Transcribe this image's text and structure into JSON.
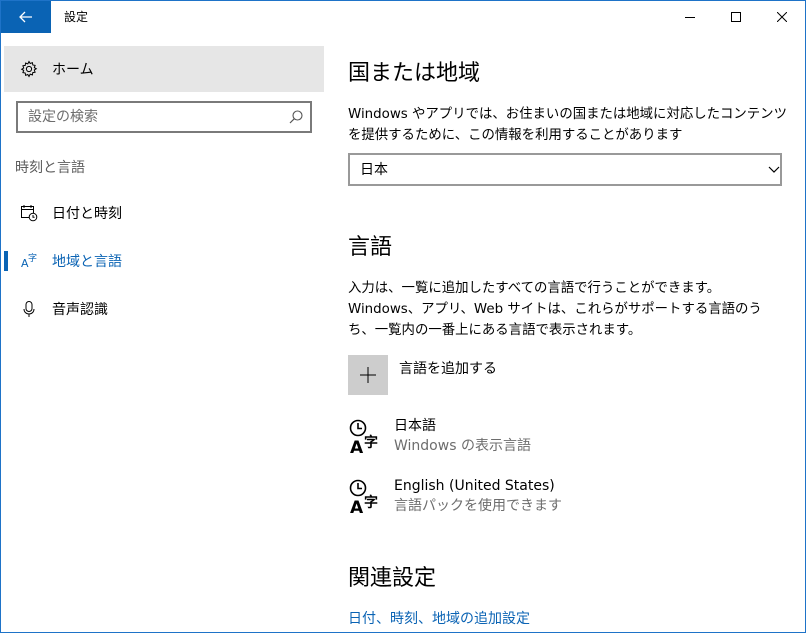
{
  "window": {
    "title": "設定"
  },
  "sidebar": {
    "home_label": "ホーム",
    "search_placeholder": "設定の検索",
    "section_label": "時刻と言語",
    "items": [
      {
        "label": "日付と時刻",
        "icon": "calendar-clock-icon"
      },
      {
        "label": "地域と言語",
        "icon": "language-region-icon",
        "active": true
      },
      {
        "label": "音声認識",
        "icon": "microphone-icon"
      }
    ]
  },
  "main": {
    "region": {
      "title": "国または地域",
      "description": "Windows やアプリでは、お住まいの国または地域に対応したコンテンツを提供するために、この情報を利用することがあります",
      "selected": "日本"
    },
    "language": {
      "title": "言語",
      "description": "入力は、一覧に追加したすべての言語で行うことができます。Windows、アプリ、Web サイトは、これらがサポートする言語のうち、一覧内の一番上にある言語で表示されます。",
      "add_label": "言語を追加する",
      "items": [
        {
          "name": "日本語",
          "sub": "Windows の表示言語"
        },
        {
          "name": "English (United States)",
          "sub": "言語パックを使用できます"
        }
      ]
    },
    "related": {
      "title": "関連設定",
      "link": "日付、時刻、地域の追加設定"
    }
  },
  "colors": {
    "accent": "#0a63b4",
    "selected_bg": "#e6e6e6",
    "border": "#1e73c8"
  }
}
